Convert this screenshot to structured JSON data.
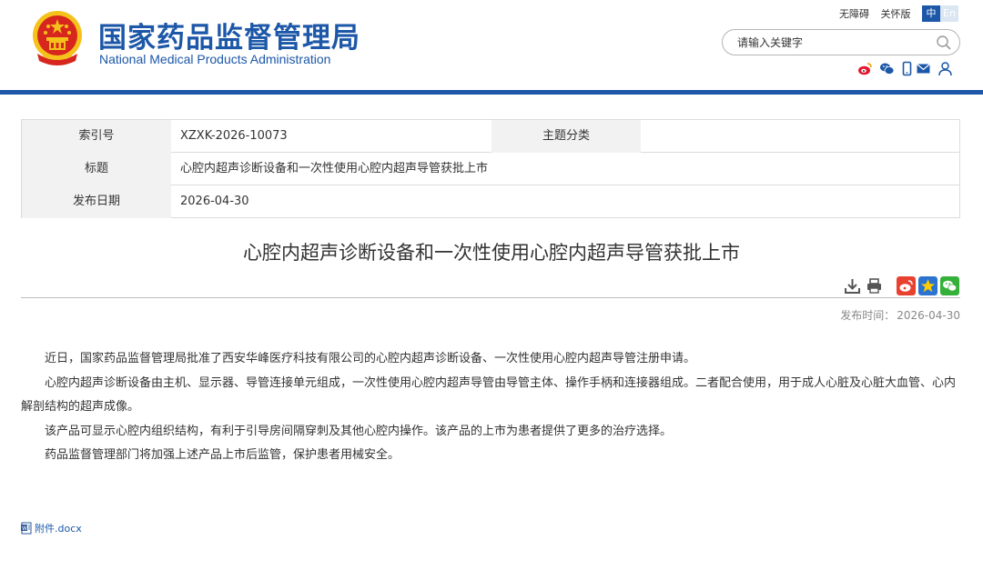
{
  "header": {
    "site_name_cn": "国家药品监督管理局",
    "site_name_en": "National Medical Products Administration",
    "links": [
      "无障碍",
      "关怀版"
    ],
    "lang_cn": "中",
    "lang_en": "En",
    "search_placeholder": "请输入关键字",
    "social_icons": [
      "weibo-icon",
      "wechat-icon",
      "mobile-icon",
      "mail-icon",
      "user-icon"
    ],
    "colors": {
      "brand": "#1c57a8",
      "emblem_red": "#d7261e",
      "emblem_gold": "#f5c11b"
    }
  },
  "meta": {
    "index_label": "索引号",
    "index_value": "XZXK-2026-10073",
    "category_label": "主题分类",
    "category_value": "",
    "title_label": "标题",
    "title_value": "心腔内超声诊断设备和一次性使用心腔内超声导管获批上市",
    "date_label": "发布日期",
    "date_value": "2026-04-30"
  },
  "article": {
    "title": "心腔内超声诊断设备和一次性使用心腔内超声导管获批上市",
    "publish_label": "发布时间：",
    "publish_date": "2026-04-30",
    "tools": [
      "download-icon",
      "print-icon"
    ],
    "share": [
      "weibo-share-icon",
      "qzone-share-icon",
      "wechat-share-icon"
    ],
    "paragraphs": [
      "近日，国家药品监督管理局批准了西安华峰医疗科技有限公司的心腔内超声诊断设备、一次性使用心腔内超声导管注册申请。",
      "心腔内超声诊断设备由主机、显示器、导管连接单元组成，一次性使用心腔内超声导管由导管主体、操作手柄和连接器组成。二者配合使用，用于成人心脏及心脏大血管、心内解剖结构的超声成像。",
      "该产品可显示心腔内组织结构，有利于引导房间隔穿刺及其他心腔内操作。该产品的上市为患者提供了更多的治疗选择。",
      "药品监督管理部门将加强上述产品上市后监管，保护患者用械安全。"
    ],
    "attachment": "附件.docx"
  }
}
